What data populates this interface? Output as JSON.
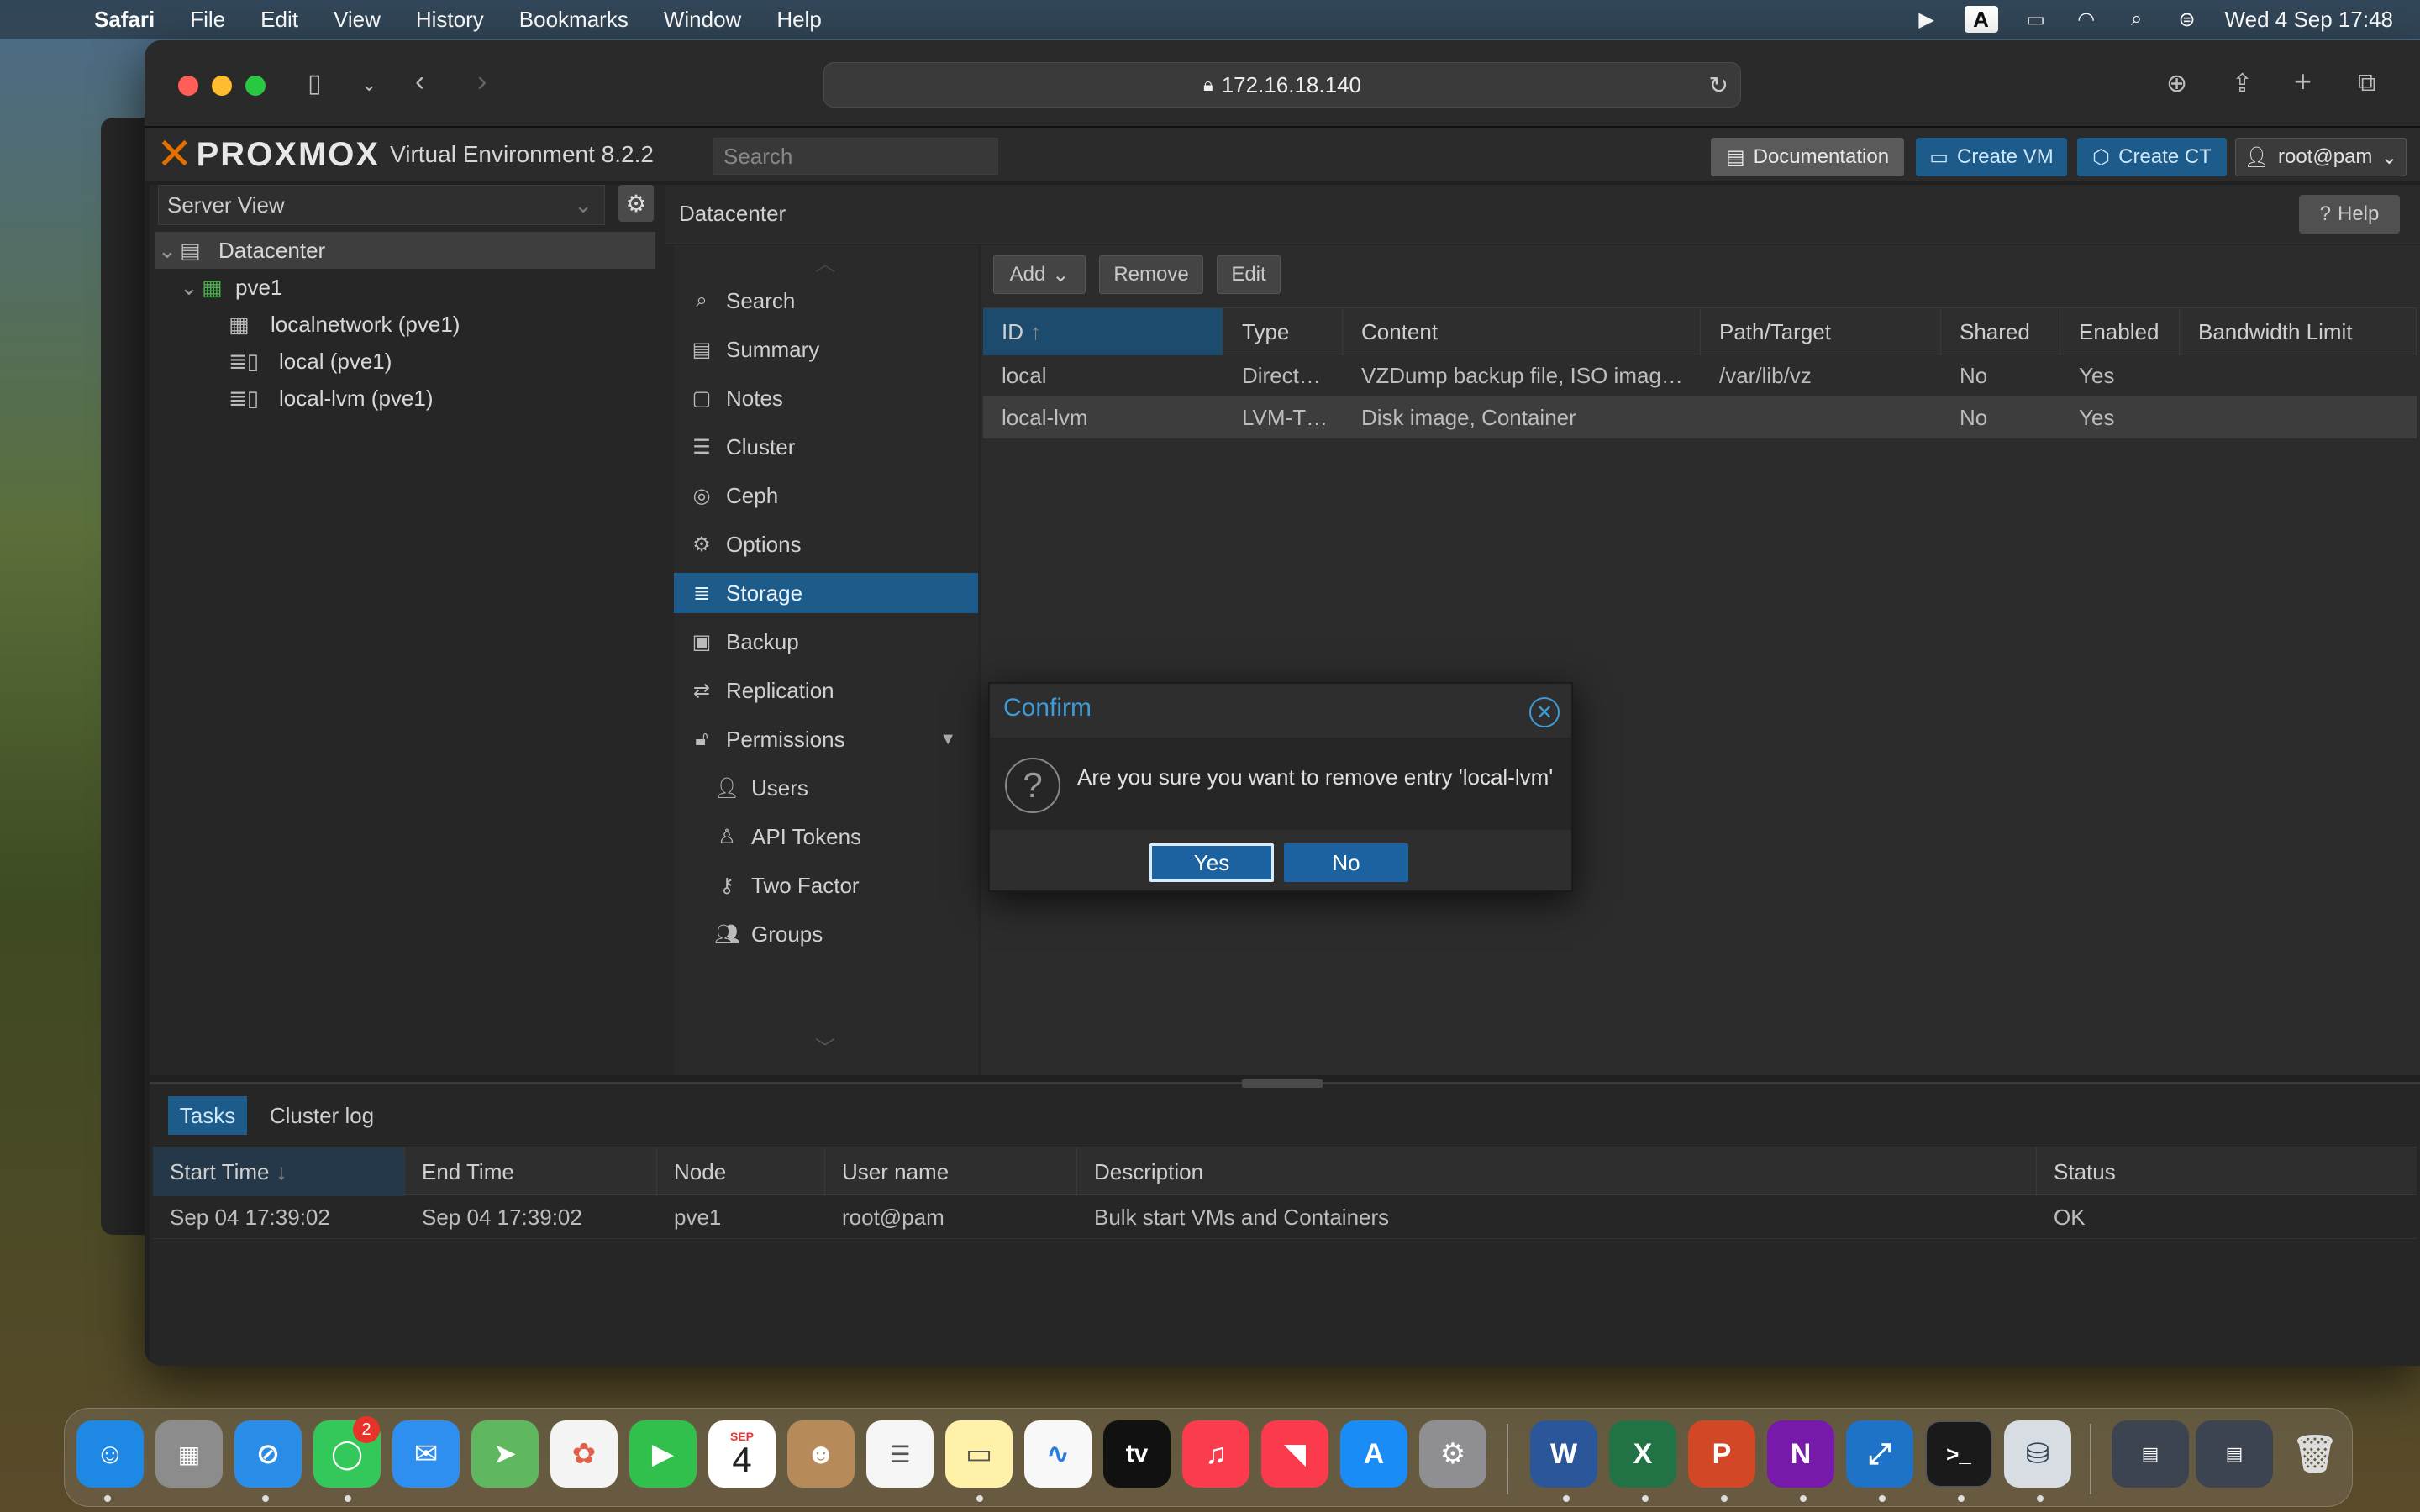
{
  "menubar": {
    "app": "Safari",
    "items": [
      "File",
      "Edit",
      "View",
      "History",
      "Bookmarks",
      "Window",
      "Help"
    ],
    "input_indicator": "A",
    "clock": "Wed 4 Sep  17:48"
  },
  "browser": {
    "url": "172.16.18.140"
  },
  "proxmox": {
    "logo_text": "PROXMOX",
    "version": "Virtual Environment 8.2.2",
    "search_placeholder": "Search",
    "documentation": "Documentation",
    "create_vm": "Create VM",
    "create_ct": "Create CT",
    "user": "root@pam",
    "help": "Help"
  },
  "tree": {
    "view": "Server View",
    "items": [
      "Datacenter",
      "pve1",
      "localnetwork (pve1)",
      "local (pve1)",
      "local-lvm (pve1)"
    ]
  },
  "breadcrumb": "Datacenter",
  "nav": {
    "items": [
      "Search",
      "Summary",
      "Notes",
      "Cluster",
      "Ceph",
      "Options",
      "Storage",
      "Backup",
      "Replication",
      "Permissions",
      "Users",
      "API Tokens",
      "Two Factor",
      "Groups"
    ],
    "selected": "Storage"
  },
  "storage": {
    "buttons": {
      "add": "Add",
      "remove": "Remove",
      "edit": "Edit"
    },
    "columns": [
      "ID",
      "Type",
      "Content",
      "Path/Target",
      "Shared",
      "Enabled",
      "Bandwidth Limit"
    ],
    "rows": [
      [
        "local",
        "Direct…",
        "VZDump backup file, ISO imag…",
        "/var/lib/vz",
        "No",
        "Yes",
        ""
      ],
      [
        "local-lvm",
        "LVM-T…",
        "Disk image, Container",
        "",
        "No",
        "Yes",
        ""
      ]
    ]
  },
  "dialog": {
    "title": "Confirm",
    "message": "Are you sure you want to remove entry 'local-lvm'",
    "yes": "Yes",
    "no": "No"
  },
  "bottom": {
    "tabs": [
      "Tasks",
      "Cluster log"
    ],
    "columns": [
      "Start Time",
      "End Time",
      "Node",
      "User name",
      "Description",
      "Status"
    ],
    "rows": [
      [
        "Sep 04 17:39:02",
        "Sep 04 17:39:02",
        "pve1",
        "root@pam",
        "Bulk start VMs and Containers",
        "OK"
      ]
    ]
  },
  "dock": {
    "messages_badge": "2",
    "calendar_month": "SEP",
    "calendar_day": "4",
    "tv_label": "tv",
    "word": "W",
    "excel": "X",
    "powerpoint": "P",
    "onenote": "N",
    "terminal": ">_"
  },
  "colors": {
    "accent": "#1d5c8a",
    "brand": "#e57000",
    "dialog_title": "#3d9bd8"
  }
}
